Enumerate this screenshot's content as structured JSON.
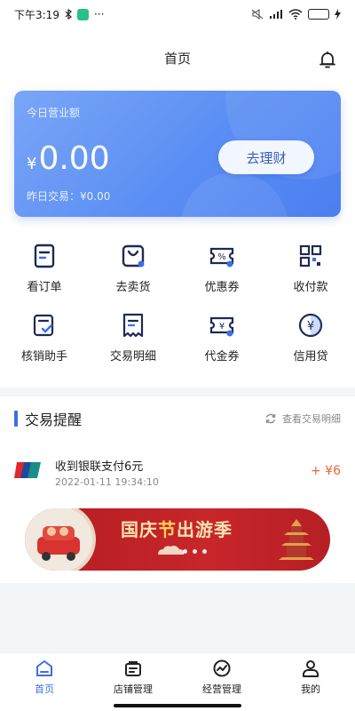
{
  "status_bar": {
    "time": "下午3:19",
    "extra": "···",
    "battery": "100"
  },
  "header": {
    "title": "首页"
  },
  "revenue": {
    "label": "今日营业额",
    "currency": "¥",
    "value": "0.00",
    "yesterday": "昨日交易：¥0.00",
    "finance_button": "去理财"
  },
  "grid": [
    {
      "label": "看订单",
      "icon": "order-icon"
    },
    {
      "label": "去卖货",
      "icon": "shop-bag-icon"
    },
    {
      "label": "优惠券",
      "icon": "coupon-icon"
    },
    {
      "label": "收付款",
      "icon": "qr-code-icon"
    },
    {
      "label": "核销助手",
      "icon": "verify-icon"
    },
    {
      "label": "交易明细",
      "icon": "receipt-icon"
    },
    {
      "label": "代金券",
      "icon": "voucher-icon"
    },
    {
      "label": "信用贷",
      "icon": "loan-icon"
    }
  ],
  "transactions": {
    "title": "交易提醒",
    "link": "查看交易明细",
    "items": [
      {
        "desc": "收到银联支付6元",
        "time": "2022-01-11 19:34:10",
        "amount": "+ ¥6"
      }
    ]
  },
  "banner": {
    "text_a": "国庆",
    "text_b": "节",
    "text_c": "出游季"
  },
  "bottom_nav": [
    {
      "label": "首页",
      "icon": "home-icon"
    },
    {
      "label": "店铺管理",
      "icon": "store-icon"
    },
    {
      "label": "经营管理",
      "icon": "trend-icon"
    },
    {
      "label": "我的",
      "icon": "user-icon"
    }
  ],
  "colors": {
    "accent": "#3b6fe8",
    "amount": "#e8673a",
    "card_start": "#7aa6f7",
    "card_end": "#4b7ff0"
  }
}
